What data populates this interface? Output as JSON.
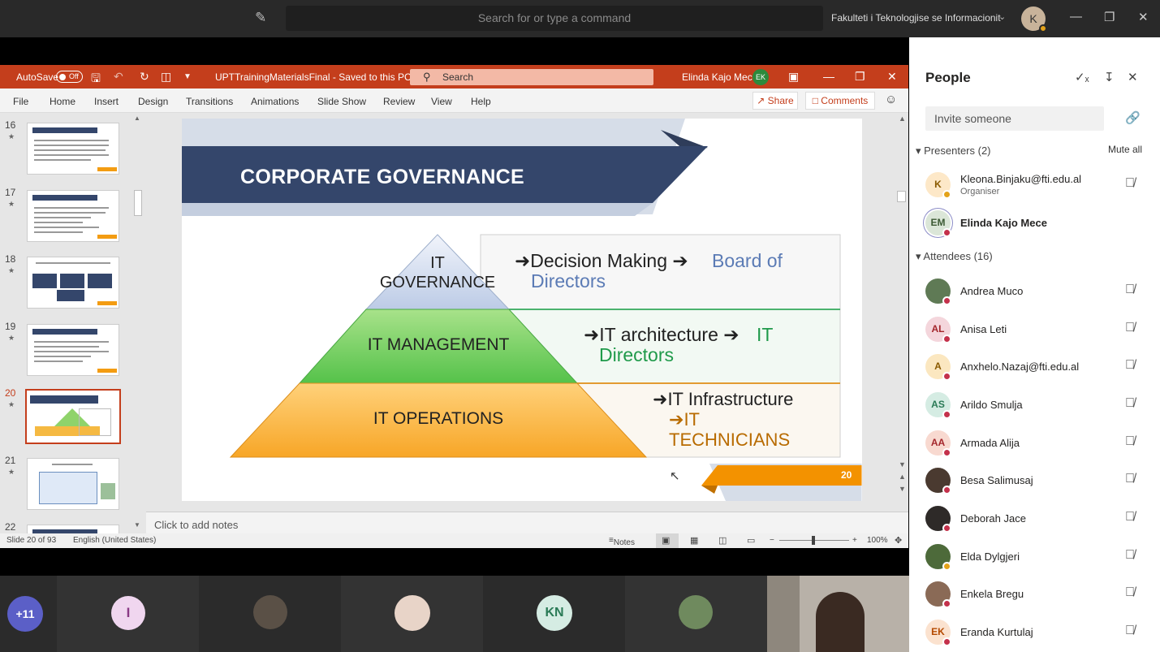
{
  "teams": {
    "search_placeholder": "Search for or type a command",
    "org_name": "Fakulteti i Teknologjise se Informacionit",
    "me_initial": "K"
  },
  "ppt": {
    "autosave": "AutoSave",
    "autosave_state": "Off",
    "file_title": "UPTTrainingMaterialsFinal - Saved to this PC",
    "search": "Search",
    "user_name": "Elinda Kajo Mece",
    "user_initials": "EK",
    "menu": [
      "File",
      "Home",
      "Insert",
      "Design",
      "Transitions",
      "Animations",
      "Slide Show",
      "Review",
      "View",
      "Help"
    ],
    "share": "Share",
    "comments": "Comments",
    "thumbnail_numbers": [
      "16",
      "17",
      "18",
      "19",
      "20",
      "21",
      "22"
    ],
    "notes_placeholder": "Click to add notes",
    "status_slide": "Slide 20 of 93",
    "status_language": "English (United States)",
    "status_notes": "Notes",
    "zoom": "100%"
  },
  "slide": {
    "title": "CORPORATE GOVERNANCE",
    "pyramid": [
      {
        "level": "IT GOVERNANCE",
        "line1": "IT",
        "line2": "GOVERNANCE",
        "desc": "Decision Making",
        "target": "Board of Directors",
        "target_line1": "Board of",
        "target_line2": "Directors"
      },
      {
        "level": "IT MANAGEMENT",
        "desc": "IT architecture",
        "target_line1": "IT",
        "target_line2": "Directors"
      },
      {
        "level": "IT OPERATIONS",
        "desc": "IT Infrastructure",
        "target_line1": "IT",
        "target_line2": "TECHNICIANS"
      }
    ],
    "page_number": "20"
  },
  "people": {
    "title": "People",
    "invite_placeholder": "Invite someone",
    "presenters_label": "Presenters (2)",
    "mute_all": "Mute all",
    "attendees_label": "Attendees (16)",
    "presenters": [
      {
        "name": "Kleona.Binjaku@fti.edu.al",
        "sub": "Organiser",
        "initials": "K",
        "color": "#fde8c8",
        "text": "#8a5a00",
        "status": "#e3a21a"
      },
      {
        "name": "Elinda Kajo Mece",
        "initials": "EM",
        "color": "#dbe6d8",
        "text": "#3c5a34",
        "status": "#c4314b"
      }
    ],
    "attendees": [
      {
        "name": "Andrea Muco",
        "initials": "",
        "color": "#5f7a55",
        "status": "#c4314b"
      },
      {
        "name": "Anisa Leti",
        "initials": "AL",
        "color": "#f4d6dc",
        "text": "#a4262c",
        "status": "#c4314b"
      },
      {
        "name": "Anxhelo.Nazaj@fti.edu.al",
        "initials": "A",
        "color": "#fbe7c0",
        "text": "#8a5a00",
        "status": "#c4314b"
      },
      {
        "name": "Arildo Smulja",
        "initials": "AS",
        "color": "#d5ece3",
        "text": "#2a7a56",
        "status": "#c4314b"
      },
      {
        "name": "Armada Alija",
        "initials": "AA",
        "color": "#f8d9d0",
        "text": "#a4262c",
        "status": "#c4314b"
      },
      {
        "name": "Besa Salimusaj",
        "initials": "",
        "color": "#4a3a30",
        "status": "#c4314b"
      },
      {
        "name": "Deborah Jace",
        "initials": "",
        "color": "#2e2a28",
        "status": "#c4314b"
      },
      {
        "name": "Elda Dylgjeri",
        "initials": "",
        "color": "#4d6a3a",
        "status": "#e3a21a"
      },
      {
        "name": "Enkela Bregu",
        "initials": "",
        "color": "#8a6a56",
        "status": "#c4314b"
      },
      {
        "name": "Eranda Kurtulaj",
        "initials": "EK",
        "color": "#fbe2cf",
        "text": "#b54a00",
        "status": "#c4314b"
      }
    ]
  },
  "strip": {
    "overflow": "+11",
    "tile_initial_1": "I",
    "tile_initial_2": "KN"
  }
}
